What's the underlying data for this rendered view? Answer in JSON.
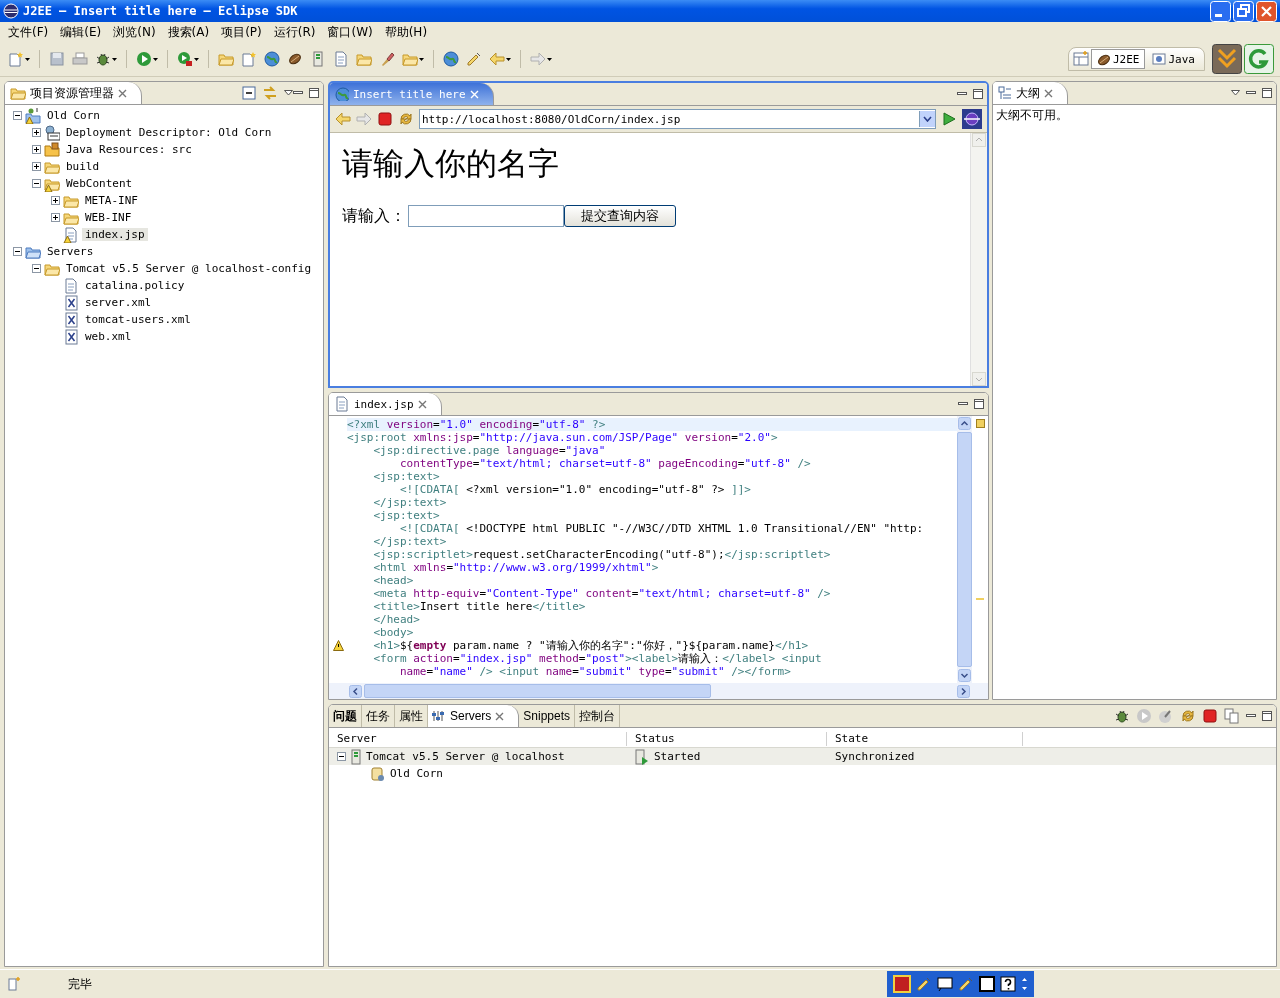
{
  "window": {
    "title": "J2EE — Insert title here — Eclipse SDK"
  },
  "menu": [
    "文件(F)",
    "编辑(E)",
    "浏览(N)",
    "搜索(A)",
    "项目(P)",
    "运行(R)",
    "窗口(W)",
    "帮助(H)"
  ],
  "perspectives": [
    {
      "label": "J2EE",
      "selected": true
    },
    {
      "label": "Java",
      "selected": false
    }
  ],
  "explorer": {
    "title": "项目资源管理器",
    "tree": [
      {
        "label": "Old Corn",
        "kind": "project",
        "selected": false,
        "warning": true,
        "expanded": true,
        "children": [
          {
            "label": "Deployment Descriptor: Old Corn",
            "kind": "descriptor",
            "selected": false,
            "warning": false,
            "expanded": false
          },
          {
            "label": "Java Resources: src",
            "kind": "java-resources",
            "selected": false,
            "warning": false,
            "expanded": false
          },
          {
            "label": "build",
            "kind": "folder",
            "selected": false,
            "warning": false,
            "expanded": false
          },
          {
            "label": "WebContent",
            "kind": "folder",
            "selected": false,
            "warning": true,
            "expanded": true,
            "children": [
              {
                "label": "META-INF",
                "kind": "folder",
                "selected": false,
                "warning": false,
                "expanded": false
              },
              {
                "label": "WEB-INF",
                "kind": "folder",
                "selected": false,
                "warning": false,
                "expanded": false
              },
              {
                "label": "index.jsp",
                "kind": "jsp-file",
                "selected": true,
                "warning": true
              }
            ]
          }
        ]
      },
      {
        "label": "Servers",
        "kind": "servers-folder",
        "selected": false,
        "warning": false,
        "expanded": true,
        "children": [
          {
            "label": "Tomcat v5.5 Server @ localhost-config",
            "kind": "folder",
            "selected": false,
            "warning": false,
            "expanded": true,
            "children": [
              {
                "label": "catalina.policy",
                "kind": "text-file",
                "selected": false,
                "warning": false
              },
              {
                "label": "server.xml",
                "kind": "xml-file",
                "selected": false,
                "warning": false
              },
              {
                "label": "tomcat-users.xml",
                "kind": "xml-file",
                "selected": false,
                "warning": false
              },
              {
                "label": "web.xml",
                "kind": "xml-file",
                "selected": false,
                "warning": false
              }
            ]
          }
        ]
      }
    ]
  },
  "browser": {
    "tab": "Insert title here",
    "url": "http://localhost:8080/OldCorn/index.jsp",
    "heading": "请输入你的名字",
    "label": "请输入：",
    "button": "提交查询内容"
  },
  "editor": {
    "tab": "index.jsp",
    "lines": [
      {
        "text": "<?xml version=\"1.0\" encoding=\"utf-8\" ?>",
        "current": true,
        "warning": false
      },
      {
        "text": "<jsp:root xmlns:jsp=\"http://java.sun.com/JSP/Page\" version=\"2.0\">",
        "current": false,
        "warning": false
      },
      {
        "text": "    <jsp:directive.page language=\"java\"",
        "current": false,
        "warning": false
      },
      {
        "text": "        contentType=\"text/html; charset=utf-8\" pageEncoding=\"utf-8\" />",
        "current": false,
        "warning": false
      },
      {
        "text": "    <jsp:text>",
        "current": false,
        "warning": false
      },
      {
        "text": "        <![CDATA[ <?xml version=\"1.0\" encoding=\"utf-8\" ?> ]]>",
        "current": false,
        "warning": false
      },
      {
        "text": "    </jsp:text>",
        "current": false,
        "warning": false
      },
      {
        "text": "    <jsp:text>",
        "current": false,
        "warning": false
      },
      {
        "text": "        <![CDATA[ <!DOCTYPE html PUBLIC \"-//W3C//DTD XHTML 1.0 Transitional//EN\" \"http:",
        "current": false,
        "warning": false
      },
      {
        "text": "    </jsp:text>",
        "current": false,
        "warning": false
      },
      {
        "text": "    <jsp:scriptlet>request.setCharacterEncoding(\"utf-8\");</jsp:scriptlet>",
        "current": false,
        "warning": false
      },
      {
        "text": "    <html xmlns=\"http://www.w3.org/1999/xhtml\">",
        "current": false,
        "warning": false
      },
      {
        "text": "    <head>",
        "current": false,
        "warning": false
      },
      {
        "text": "    <meta http-equiv=\"Content-Type\" content=\"text/html; charset=utf-8\" />",
        "current": false,
        "warning": false
      },
      {
        "text": "    <title>Insert title here</title>",
        "current": false,
        "warning": false
      },
      {
        "text": "    </head>",
        "current": false,
        "warning": false
      },
      {
        "text": "    <body>",
        "current": false,
        "warning": false
      },
      {
        "text": "    <h1>${**empty** param.name ? \"请输入你的名字\":\"你好，\"}${param.name}</h1>",
        "current": false,
        "warning": true
      },
      {
        "text": "    <form action=\"index.jsp\" method=\"post\"><label>请输入：</label> <input",
        "current": false,
        "warning": false
      },
      {
        "text": "        name=\"name\" /> <input name=\"submit\" type=\"submit\" /></form>",
        "current": false,
        "warning": false
      }
    ]
  },
  "outline": {
    "tab": "大纲",
    "message": "大纲不可用。"
  },
  "bottom": {
    "tabs": [
      {
        "label": "问题",
        "kind": "plain",
        "selected": false
      },
      {
        "label": "任务",
        "kind": "plain",
        "selected": false
      },
      {
        "label": "属性",
        "kind": "plain",
        "selected": false
      },
      {
        "label": "Servers",
        "kind": "servers",
        "selected": true
      },
      {
        "label": "Snippets",
        "kind": "plain",
        "selected": false
      },
      {
        "label": "控制台",
        "kind": "plain",
        "selected": false
      }
    ],
    "columns": [
      "Server",
      "Status",
      "State"
    ],
    "rows": [
      {
        "server": "Tomcat v5.5 Server @ localhost",
        "status": "Started",
        "state": "Synchronized",
        "selected": true,
        "expanded": true,
        "children": [
          {
            "server": "Old Corn",
            "selected": false
          }
        ]
      }
    ]
  },
  "status_bar": {
    "message": "完毕"
  }
}
